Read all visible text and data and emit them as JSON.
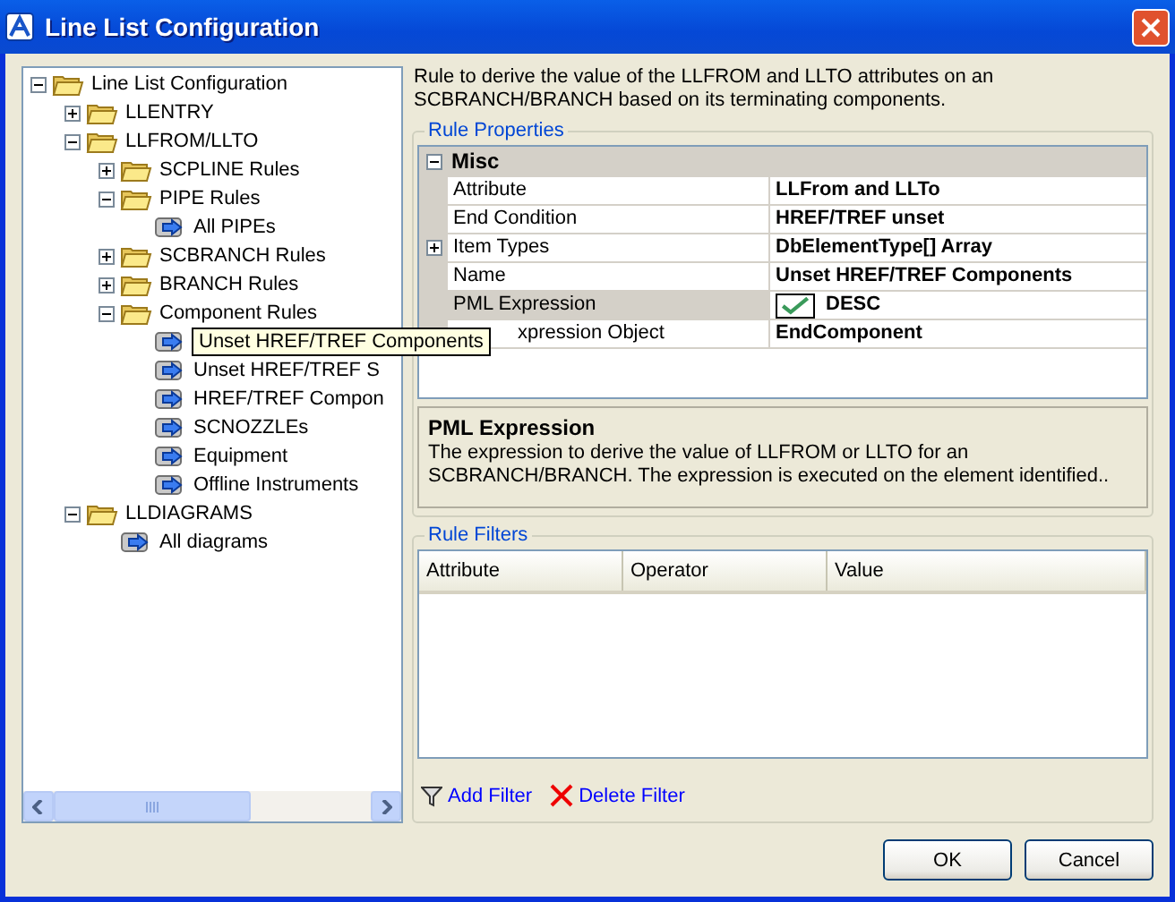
{
  "window": {
    "title": "Line List Configuration"
  },
  "tree": [
    {
      "label": "Line List Configuration",
      "kind": "folder",
      "expanded": true,
      "children": [
        {
          "label": "LLENTRY",
          "kind": "folder",
          "expanded": false
        },
        {
          "label": "LLFROM/LLTO",
          "kind": "folder",
          "expanded": true,
          "children": [
            {
              "label": "SCPLINE Rules",
              "kind": "folder",
              "expanded": false
            },
            {
              "label": "PIPE Rules",
              "kind": "folder",
              "expanded": true,
              "children": [
                {
                  "label": "All PIPEs",
                  "kind": "rule"
                }
              ]
            },
            {
              "label": "SCBRANCH Rules",
              "kind": "folder",
              "expanded": false
            },
            {
              "label": "BRANCH Rules",
              "kind": "folder",
              "expanded": false
            },
            {
              "label": "Component Rules",
              "kind": "folder",
              "expanded": true,
              "children": [
                {
                  "label": "Unset HREF/TREF Components",
                  "kind": "rule",
                  "tooltip": true
                },
                {
                  "label": "Unset HREF/TREF S",
                  "kind": "rule"
                },
                {
                  "label": "HREF/TREF Compon",
                  "kind": "rule"
                },
                {
                  "label": "SCNOZZLEs",
                  "kind": "rule"
                },
                {
                  "label": "Equipment",
                  "kind": "rule"
                },
                {
                  "label": "Offline Instruments",
                  "kind": "rule"
                }
              ]
            }
          ]
        },
        {
          "label": "LLDIAGRAMS",
          "kind": "folder",
          "expanded": true,
          "children": [
            {
              "label": "All diagrams",
              "kind": "rule"
            }
          ]
        }
      ]
    }
  ],
  "description": "Rule to derive the value of the LLFROM and LLTO attributes on an SCBRANCH/BRANCH based on its terminating components.",
  "rule_properties": {
    "title": "Rule Properties",
    "group": {
      "label": "Misc",
      "expanded": true
    },
    "rows": [
      {
        "name": "Attribute",
        "value": "LLFrom and LLTo",
        "kind": "text",
        "expandable": false,
        "selected": false,
        "covered": false
      },
      {
        "name": "End Condition",
        "value": "HREF/TREF unset",
        "kind": "text",
        "expandable": false,
        "selected": false,
        "covered": false
      },
      {
        "name": "Item Types",
        "value": "DbElementType[] Array",
        "kind": "text",
        "expandable": true,
        "selected": false,
        "covered": false
      },
      {
        "name": "Name",
        "value": "Unset HREF/TREF Components",
        "kind": "text",
        "expandable": false,
        "selected": false,
        "covered": false
      },
      {
        "name": "PML Expression",
        "value": "DESC",
        "kind": "check",
        "expandable": false,
        "selected": true,
        "covered": false
      },
      {
        "name": "xpression Object",
        "value": "EndComponent",
        "kind": "text",
        "expandable": false,
        "selected": false,
        "covered": true
      }
    ],
    "help_title": "PML Expression",
    "help_text": "The expression to derive the value of LLFROM or LLTO for an SCBRANCH/BRANCH.  The expression is executed on the element identified.."
  },
  "rule_filters": {
    "title": "Rule Filters",
    "columns": [
      "Attribute",
      "Operator",
      "Value"
    ],
    "actions": [
      {
        "label": "Add Filter",
        "kind": "add"
      },
      {
        "label": "Delete Filter",
        "kind": "delete"
      }
    ]
  },
  "buttons": [
    "OK",
    "Cancel"
  ]
}
